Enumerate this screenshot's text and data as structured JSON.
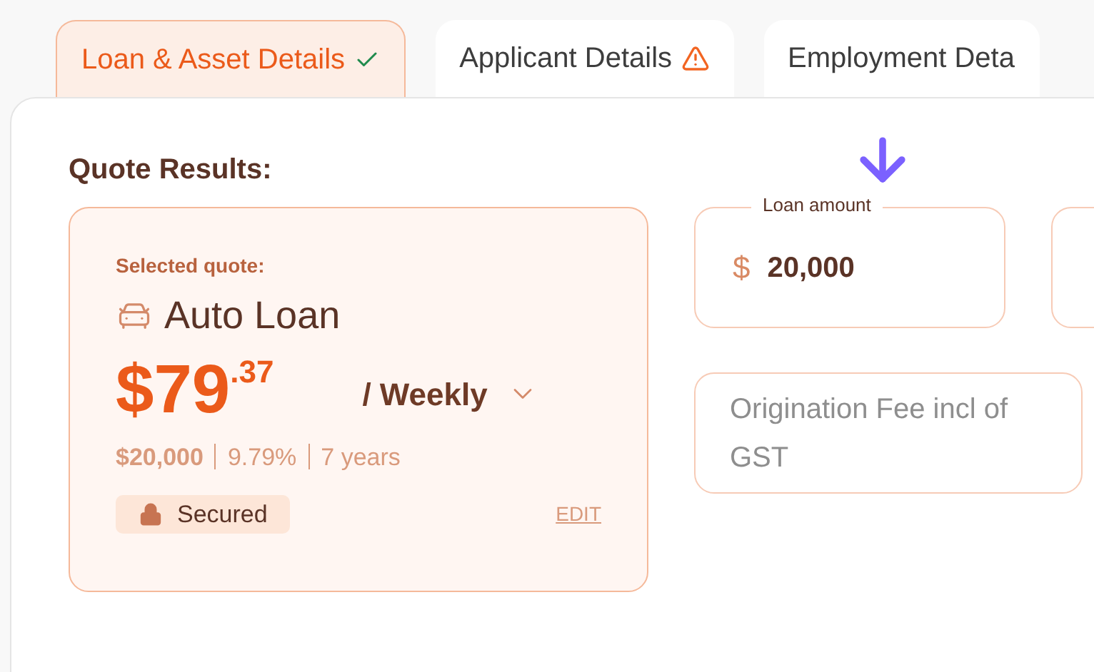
{
  "tabs": [
    {
      "label": "Loan & Asset Details",
      "selected": true,
      "kind": "complete"
    },
    {
      "label": "Applicant Details",
      "selected": false,
      "kind": "warning"
    },
    {
      "label": "Employment Deta",
      "selected": false,
      "kind": "plain"
    }
  ],
  "section_title": "Quote Results:",
  "selected_quote": {
    "caption": "Selected quote:",
    "product": "Auto Loan",
    "amount_main": "$79",
    "amount_cents": ".37",
    "frequency": "/ Weekly",
    "details": [
      "$20,000",
      "9.79%",
      "7 years"
    ],
    "badge": "Secured",
    "edit_link": "EDIT"
  },
  "fields": [
    {
      "label": "Loan amount",
      "prefix": "$",
      "value": "20,000"
    }
  ],
  "fee_field": {
    "placeholder": "Origination Fee incl of GST"
  }
}
